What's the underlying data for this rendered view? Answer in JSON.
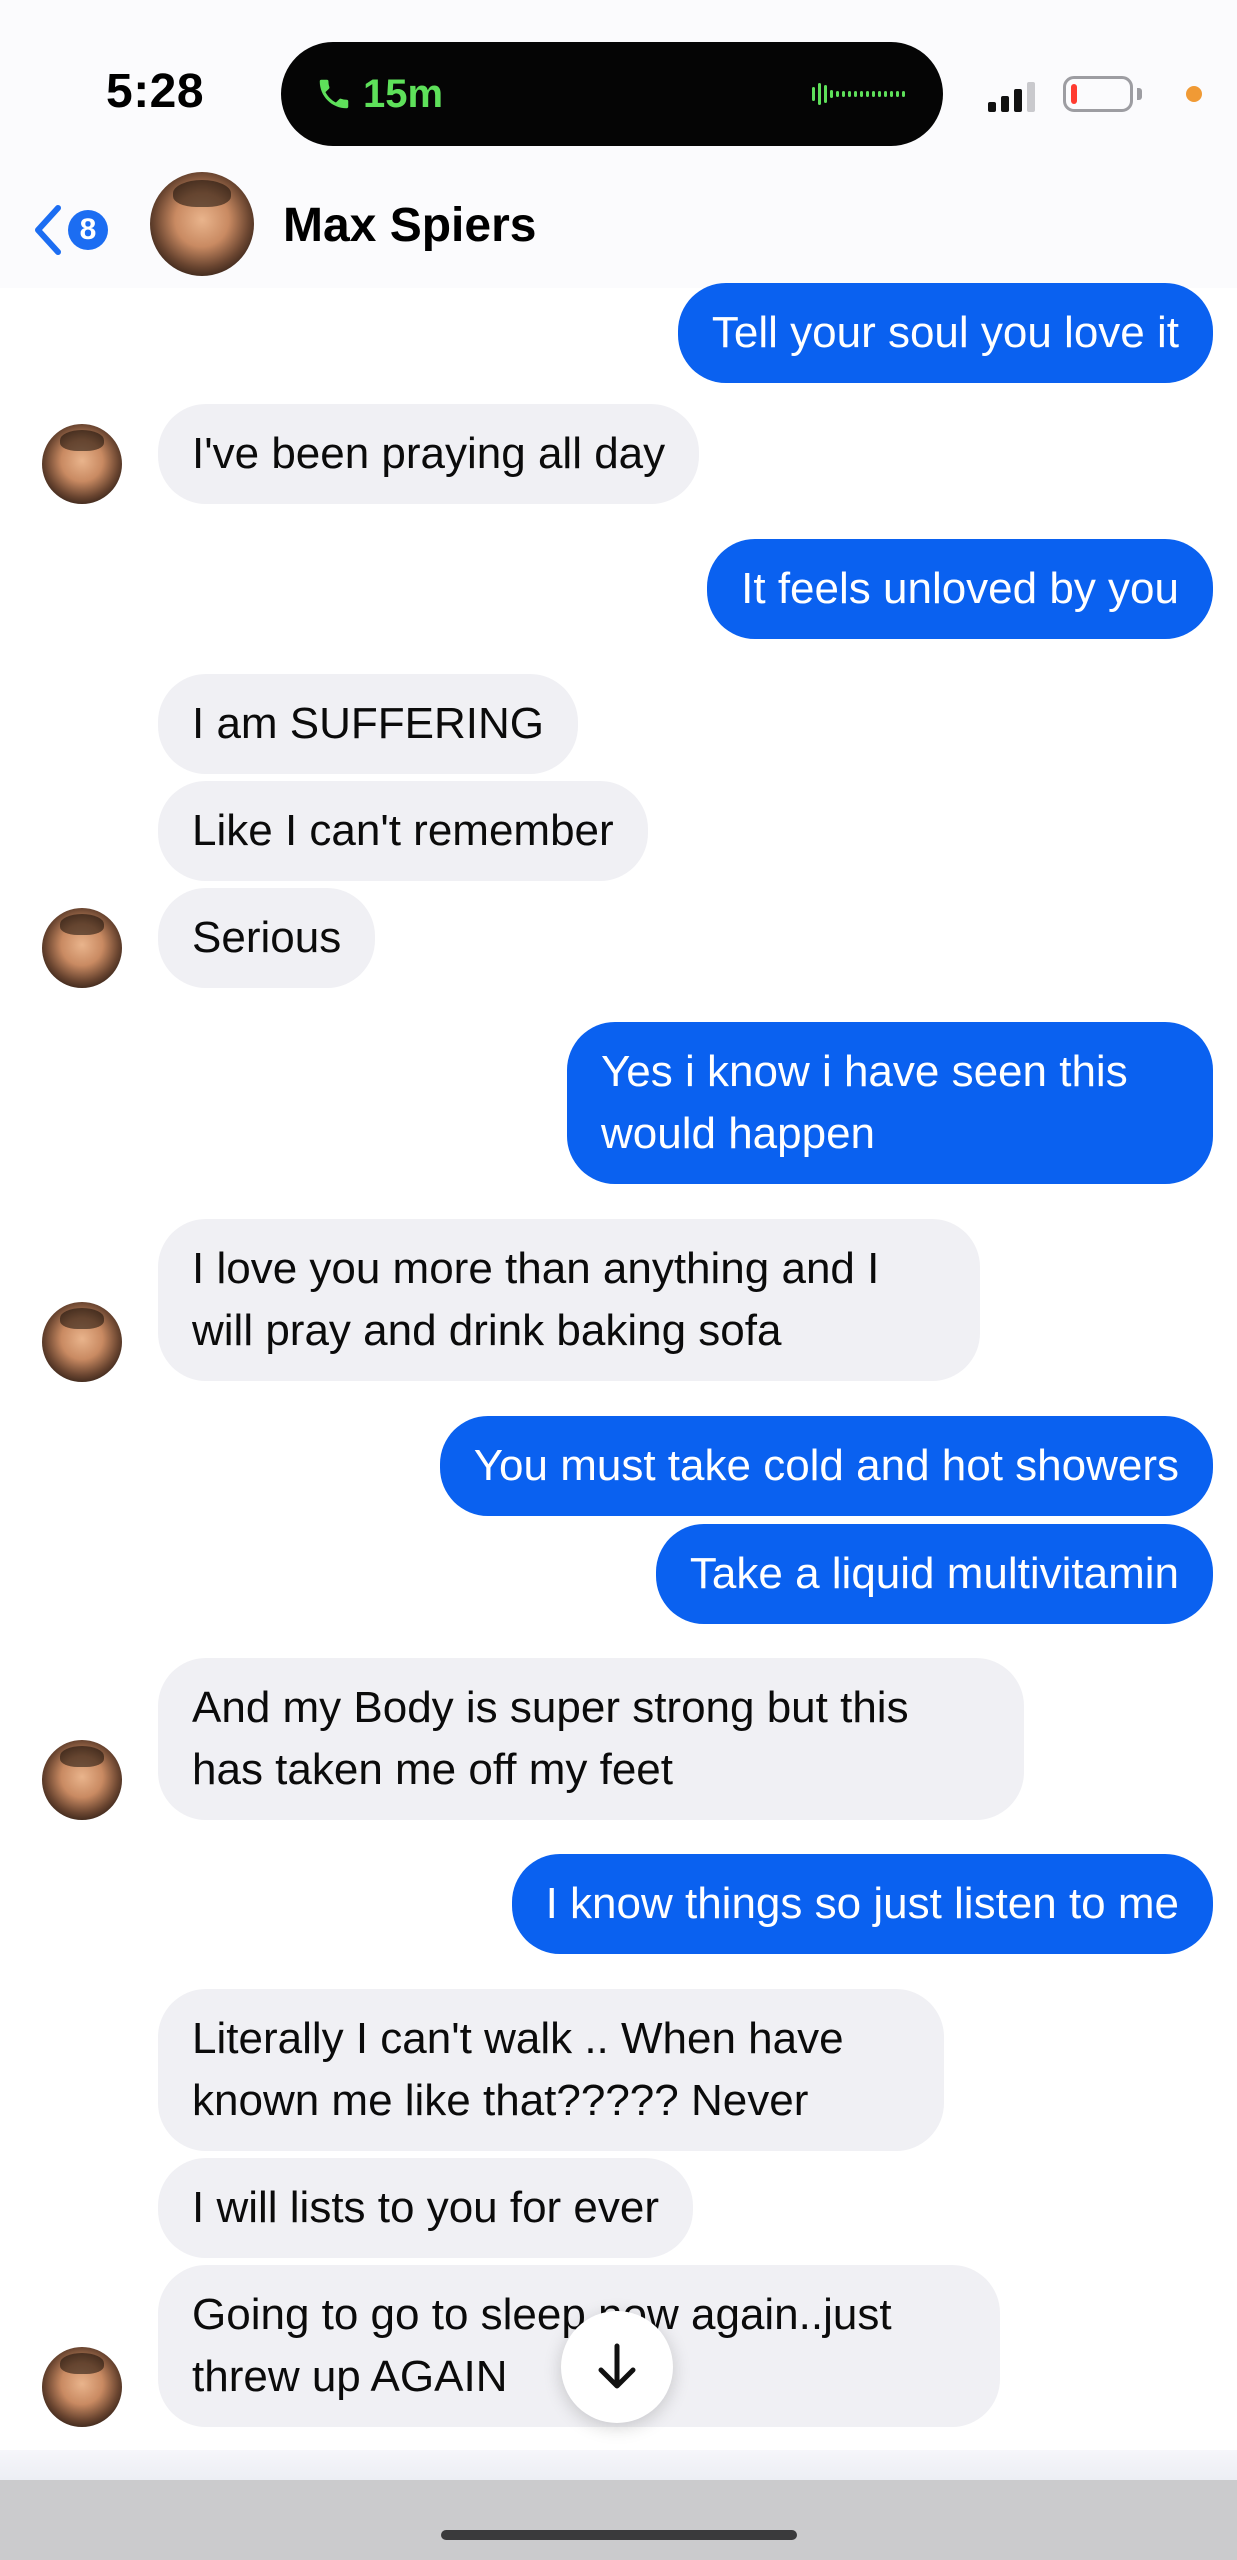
{
  "status_bar": {
    "time": "5:28",
    "call_duration": "15m",
    "call_icon": "phone-icon",
    "accent_color": "#5ee05a"
  },
  "header": {
    "back_icon": "chevron-left-icon",
    "unread_count": "8",
    "contact_name": "Max Spiers",
    "accent_color": "#1c6df2"
  },
  "messages": [
    {
      "side": "outgoing",
      "text": "Tell your soul you love it"
    },
    {
      "side": "incoming",
      "text": "I've been praying all day"
    },
    {
      "side": "outgoing",
      "text": "It feels unloved by you"
    },
    {
      "side": "incoming",
      "text": "I am SUFFERING"
    },
    {
      "side": "incoming",
      "text": "Like I can't remember"
    },
    {
      "side": "incoming",
      "text": "Serious"
    },
    {
      "side": "outgoing",
      "text": "Yes i know i have seen this would happen"
    },
    {
      "side": "incoming",
      "text": "I love you more than anything and I will pray and drink baking sofa"
    },
    {
      "side": "outgoing",
      "text": "You must take cold and hot showers"
    },
    {
      "side": "outgoing",
      "text": "Take a liquid multivitamin"
    },
    {
      "side": "incoming",
      "text": "And my Body is super strong but this has taken me off my feet"
    },
    {
      "side": "outgoing",
      "text": "I know things so just listen to me"
    },
    {
      "side": "incoming",
      "text": "Literally I can't walk .. When have known me like that????? Never"
    },
    {
      "side": "incoming",
      "text": "I will lists to you for ever"
    },
    {
      "side": "incoming",
      "text": "Going to go to sleep now again..just threw up AGAIN"
    }
  ],
  "colors": {
    "outgoing_bubble": "#0a61f0",
    "incoming_bubble": "#f0f0f4"
  },
  "scroll_button_icon": "arrow-down-icon"
}
